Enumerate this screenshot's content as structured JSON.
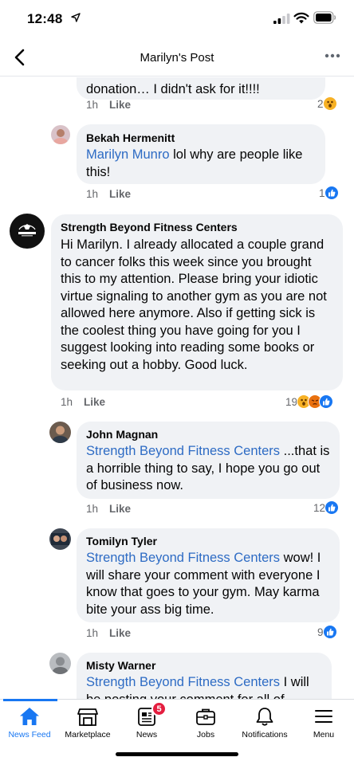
{
  "status_bar": {
    "time": "12:48"
  },
  "header": {
    "title": "Marilyn's Post"
  },
  "comments": [
    {
      "author": "",
      "mention": "",
      "text": "donation… I didn't ask for it!!!!",
      "time": "1h",
      "like_label": "Like",
      "reaction_count": "2",
      "reactions": [
        "wow"
      ]
    },
    {
      "author": "Bekah Hermenitt",
      "mention": "Marilyn Munro",
      "text": " lol why are people like this!",
      "time": "1h",
      "like_label": "Like",
      "reaction_count": "1",
      "reactions": [
        "like"
      ]
    },
    {
      "author": "Strength Beyond Fitness Centers",
      "mention": "",
      "text": "Hi Marilyn. I already allocated a couple grand to cancer folks this week since you brought this to my attention. Please bring your idiotic virtue signaling to another gym as you are not allowed here anymore. Also if getting sick is the coolest thing you have going for you I suggest looking into reading some books or seeking out a hobby. Good luck.",
      "time": "1h",
      "like_label": "Like",
      "reaction_count": "19",
      "reactions": [
        "wow",
        "angry",
        "like"
      ]
    },
    {
      "author": "John Magnan",
      "mention": "Strength Beyond Fitness Centers",
      "text": " ...that is a horrible thing to say, I hope you go out of business now.",
      "time": "1h",
      "like_label": "Like",
      "reaction_count": "12",
      "reactions": [
        "like"
      ]
    },
    {
      "author": "Tomilyn Tyler",
      "mention": "Strength Beyond Fitness Centers",
      "text": " wow! I will share your comment with everyone I know that goes to your gym. May karma bite your ass big time.",
      "time": "1h",
      "like_label": "Like",
      "reaction_count": "9",
      "reactions": [
        "like"
      ]
    },
    {
      "author": "Misty Warner",
      "mention": "Strength Beyond Fitness Centers",
      "text": " I will be posting your comment for all of",
      "time": "",
      "like_label": "",
      "reaction_count": "",
      "reactions": []
    }
  ],
  "tabbar": {
    "items": [
      {
        "label": "News Feed",
        "icon": "home-icon",
        "active": true
      },
      {
        "label": "Marketplace",
        "icon": "marketplace-icon"
      },
      {
        "label": "News",
        "icon": "news-icon",
        "badge": "5"
      },
      {
        "label": "Jobs",
        "icon": "briefcase-icon"
      },
      {
        "label": "Notifications",
        "icon": "bell-icon"
      },
      {
        "label": "Menu",
        "icon": "menu-icon"
      }
    ]
  },
  "colors": {
    "accent": "#1877f2",
    "mention": "#2d6bc4",
    "bubble": "#f0f2f5",
    "badge": "#e41e3f"
  }
}
